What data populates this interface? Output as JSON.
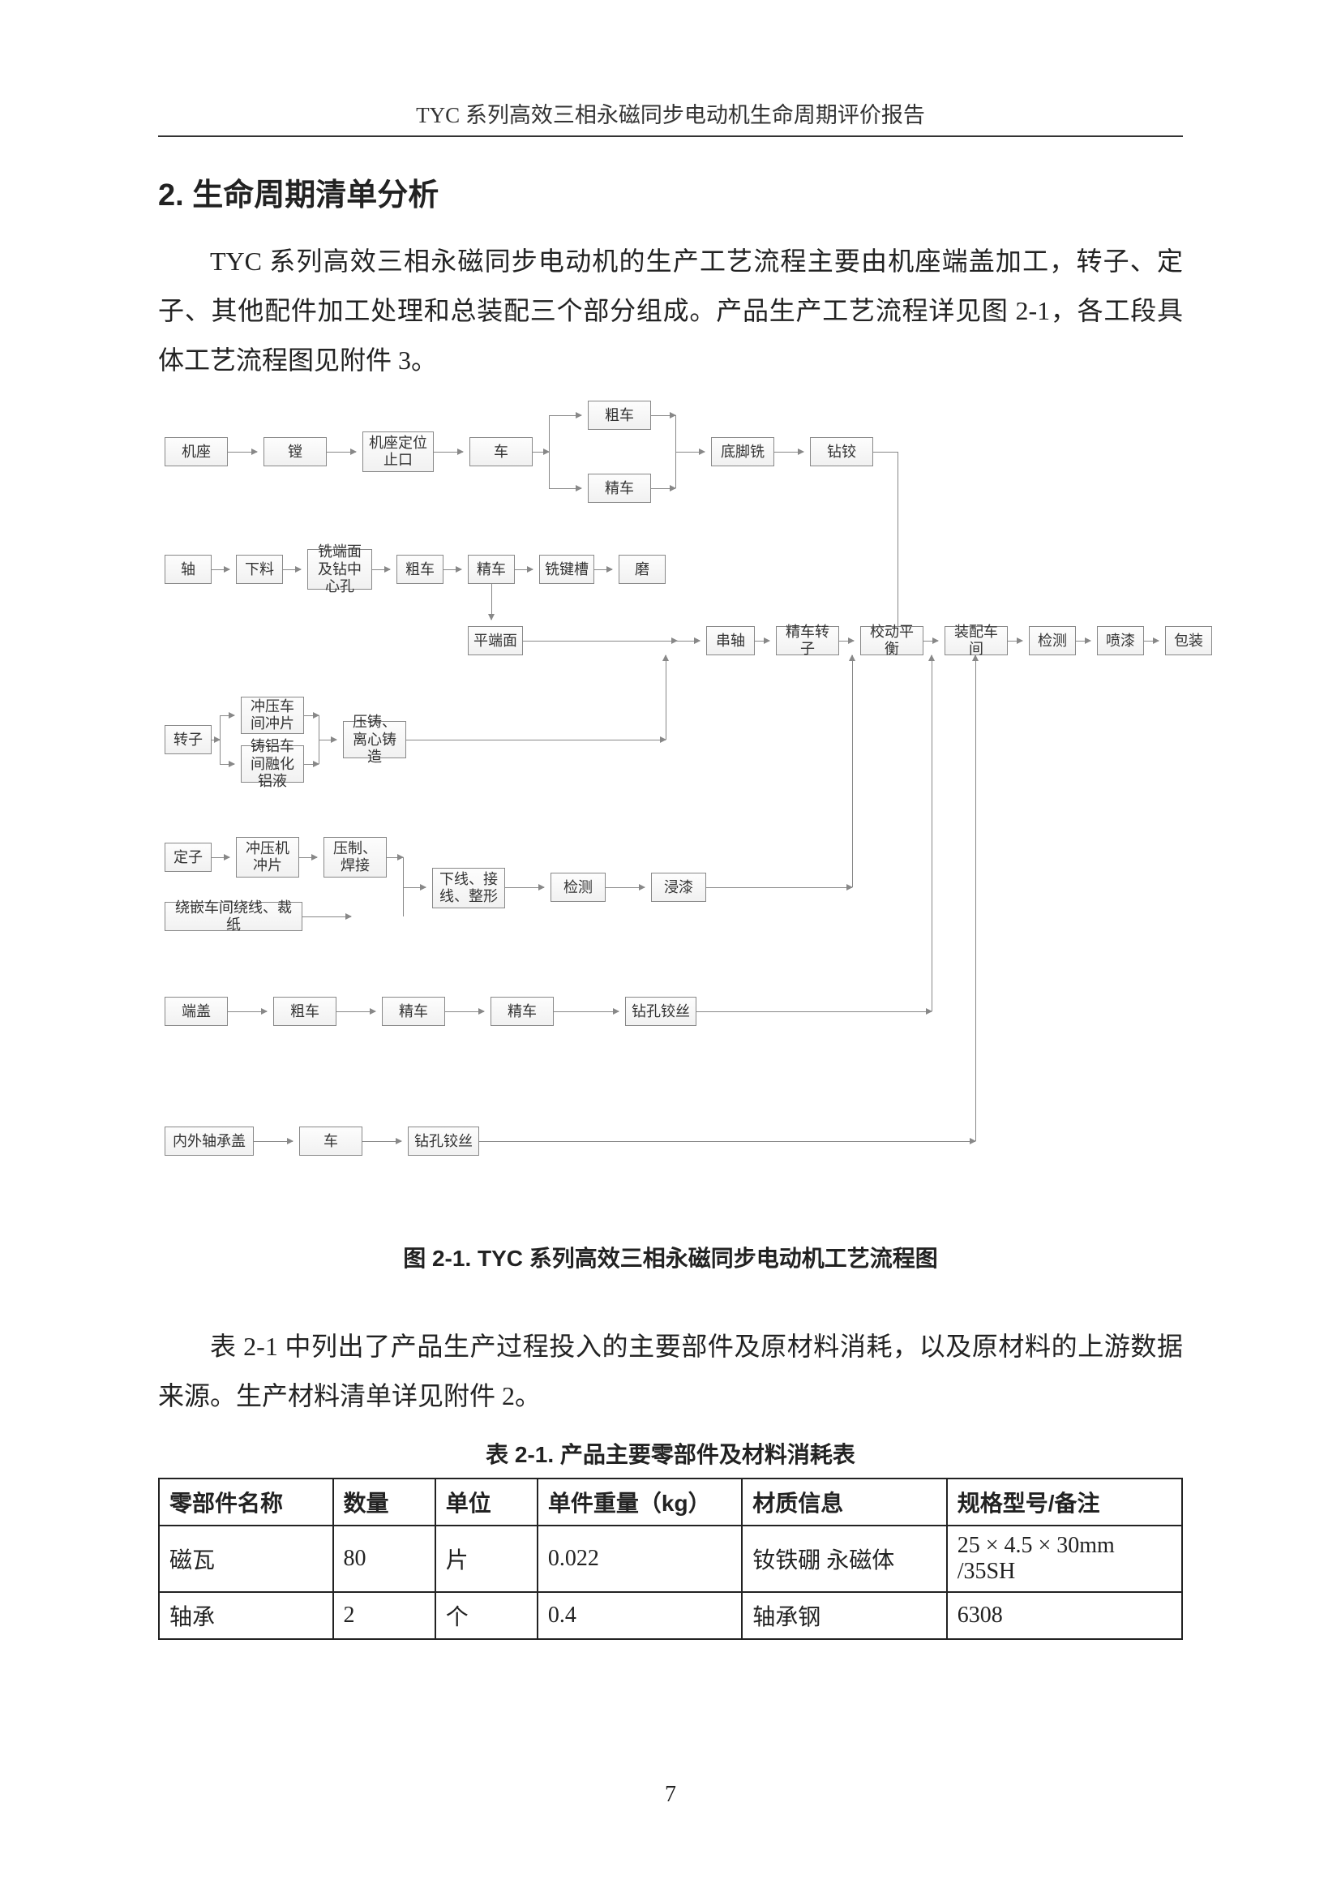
{
  "header": "TYC 系列高效三相永磁同步电动机生命周期评价报告",
  "section_title": "2. 生命周期清单分析",
  "para1": "TYC 系列高效三相永磁同步电动机的生产工艺流程主要由机座端盖加工，转子、定子、其他配件加工处理和总装配三个部分组成。产品生产工艺流程详见图 2-1，各工段具体工艺流程图见附件 3。",
  "figure_caption": "图 2-1. TYC 系列高效三相永磁同步电动机工艺流程图",
  "para2": "表 2-1 中列出了产品生产过程投入的主要部件及原材料消耗，以及原材料的上游数据来源。生产材料清单详见附件 2。",
  "table_caption": "表 2-1. 产品主要零部件及材料消耗表",
  "table": {
    "headers": [
      "零部件名称",
      "数量",
      "单位",
      "单件重量（kg）",
      "材质信息",
      "规格型号/备注"
    ],
    "rows": [
      [
        "磁瓦",
        "80",
        "片",
        "0.022",
        "钕铁硼 永磁体",
        "25 × 4.5 × 30mm /35SH"
      ],
      [
        "轴承",
        "2",
        "个",
        "0.4",
        "轴承钢",
        "6308"
      ]
    ]
  },
  "page_number": "7",
  "flow": {
    "r1": {
      "n1": "机座",
      "n2": "镗",
      "n3": "机座定位止口",
      "n4": "车",
      "n5": "粗车",
      "n6": "精车",
      "n7": "底脚铣",
      "n8": "钻铰"
    },
    "r2": {
      "n1": "轴",
      "n2": "下料",
      "n3": "铣端面及钻中心孔",
      "n4": "粗车",
      "n5": "精车",
      "n6": "铣键槽",
      "n7": "磨",
      "n8": "平端面"
    },
    "r3": {
      "n1": "串轴",
      "n2": "精车转子",
      "n3": "校动平衡",
      "n4": "装配车间",
      "n5": "检测",
      "n6": "喷漆",
      "n7": "包装"
    },
    "r4": {
      "n1": "转子",
      "n2": "冲压车间冲片",
      "n3": "铸铝车间融化铝液",
      "n4": "压铸、离心铸造"
    },
    "r5": {
      "n1": "定子",
      "n2": "冲压机冲片",
      "n3": "压制、焊接",
      "n4": "绕嵌车间绕线、裁纸",
      "n5": "下线、接线、整形",
      "n6": "检测",
      "n7": "浸漆"
    },
    "r6": {
      "n1": "端盖",
      "n2": "粗车",
      "n3": "精车",
      "n4": "精车",
      "n5": "钻孔铰丝"
    },
    "r7": {
      "n1": "内外轴承盖",
      "n2": "车",
      "n3": "钻孔铰丝"
    }
  }
}
